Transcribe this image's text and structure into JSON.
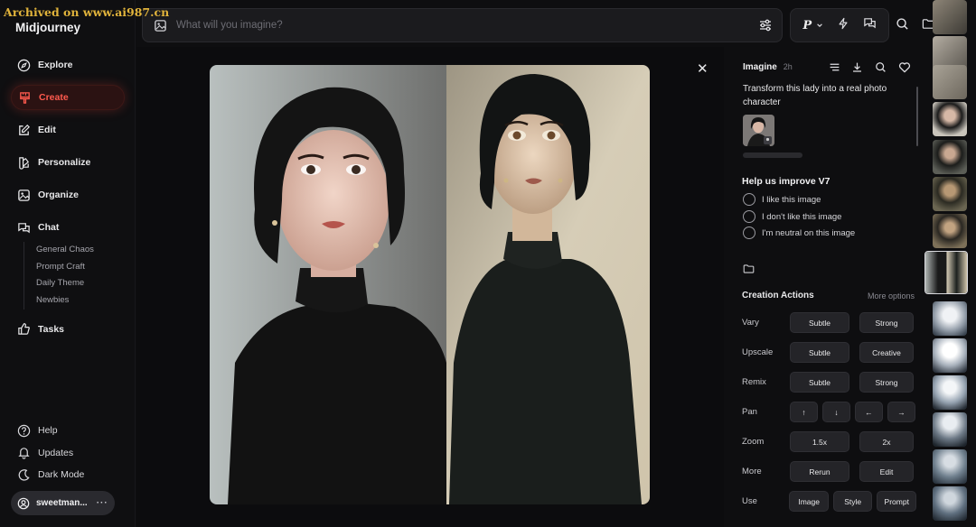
{
  "watermark": "Archived on www.ai987.cn",
  "brand": "Midjourney",
  "nav": {
    "explore": "Explore",
    "create": "Create",
    "edit": "Edit",
    "personalize": "Personalize",
    "organize": "Organize",
    "chat": "Chat",
    "chat_rooms": [
      "General Chaos",
      "Prompt Craft",
      "Daily Theme",
      "Newbies"
    ],
    "tasks": "Tasks"
  },
  "bottom_nav": {
    "help": "Help",
    "updates": "Updates",
    "dark_mode": "Dark Mode"
  },
  "user": {
    "name": "sweetman..."
  },
  "search": {
    "placeholder": "What will you imagine?"
  },
  "toolbar": {
    "profile_letter": "P"
  },
  "panel": {
    "mode": "Imagine",
    "age": "2h",
    "prompt": "Transform this lady into a real photo character",
    "feedback": {
      "title": "Help us improve V7",
      "options": [
        "I like this image",
        "I don't like this image",
        "I'm neutral on this image"
      ]
    },
    "creation_actions": {
      "title": "Creation Actions",
      "more": "More options",
      "rows": [
        {
          "label": "Vary",
          "buttons": [
            "Subtle",
            "Strong"
          ]
        },
        {
          "label": "Upscale",
          "buttons": [
            "Subtle",
            "Creative"
          ]
        },
        {
          "label": "Remix",
          "buttons": [
            "Subtle",
            "Strong"
          ]
        },
        {
          "label": "Pan",
          "buttons": [
            "↑",
            "↓",
            "←",
            "→"
          ]
        },
        {
          "label": "Zoom",
          "buttons": [
            "1.5x",
            "2x"
          ]
        },
        {
          "label": "More",
          "buttons": [
            "Rerun",
            "Edit"
          ]
        },
        {
          "label": "Use",
          "buttons": [
            "Image",
            "Style",
            "Prompt"
          ]
        }
      ]
    }
  },
  "colors": {
    "accent": "#ff5a4e",
    "panel_bg": "#0e0e10",
    "button_bg": "#242428"
  }
}
